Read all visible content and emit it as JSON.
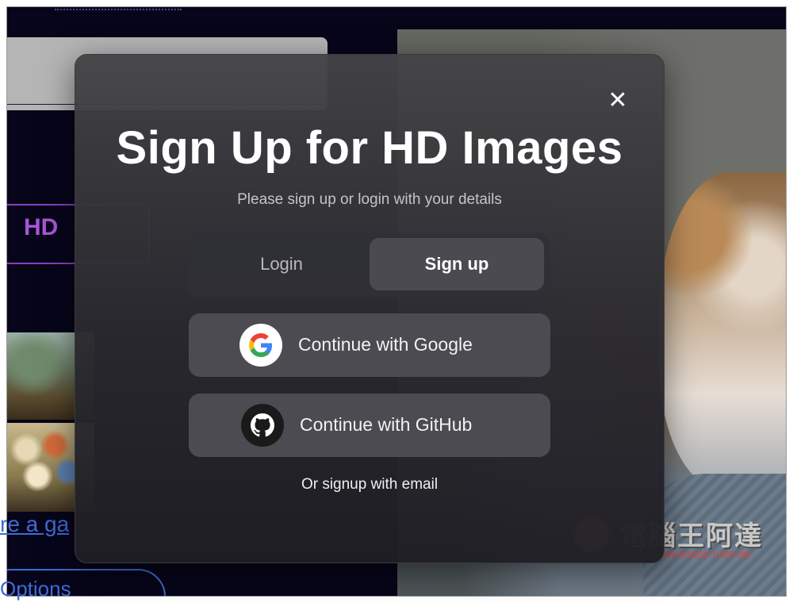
{
  "modal": {
    "title": "Sign Up for HD Images",
    "subtitle": "Please sign up or login with your details",
    "close_glyph": "✕",
    "tabs": [
      {
        "label": "Login",
        "active": false
      },
      {
        "label": "Sign up",
        "active": true
      }
    ],
    "providers": [
      {
        "label": "Continue with Google",
        "icon": "google-icon"
      },
      {
        "label": "Continue with GitHub",
        "icon": "github-icon"
      }
    ],
    "email_link": "Or signup with email"
  },
  "background": {
    "hd_badge": "HD",
    "link_text": "re a ga",
    "options_text": "Options"
  },
  "watermark": {
    "title": "電腦王阿達",
    "url": "http://www.kocpc.com.tw"
  },
  "colors": {
    "page_bg": "#07051a",
    "modal_bg": "#2e2d33",
    "button_bg": "#4b4b51",
    "accent_purple": "#a855d8",
    "link_blue": "#3e6bd6"
  }
}
